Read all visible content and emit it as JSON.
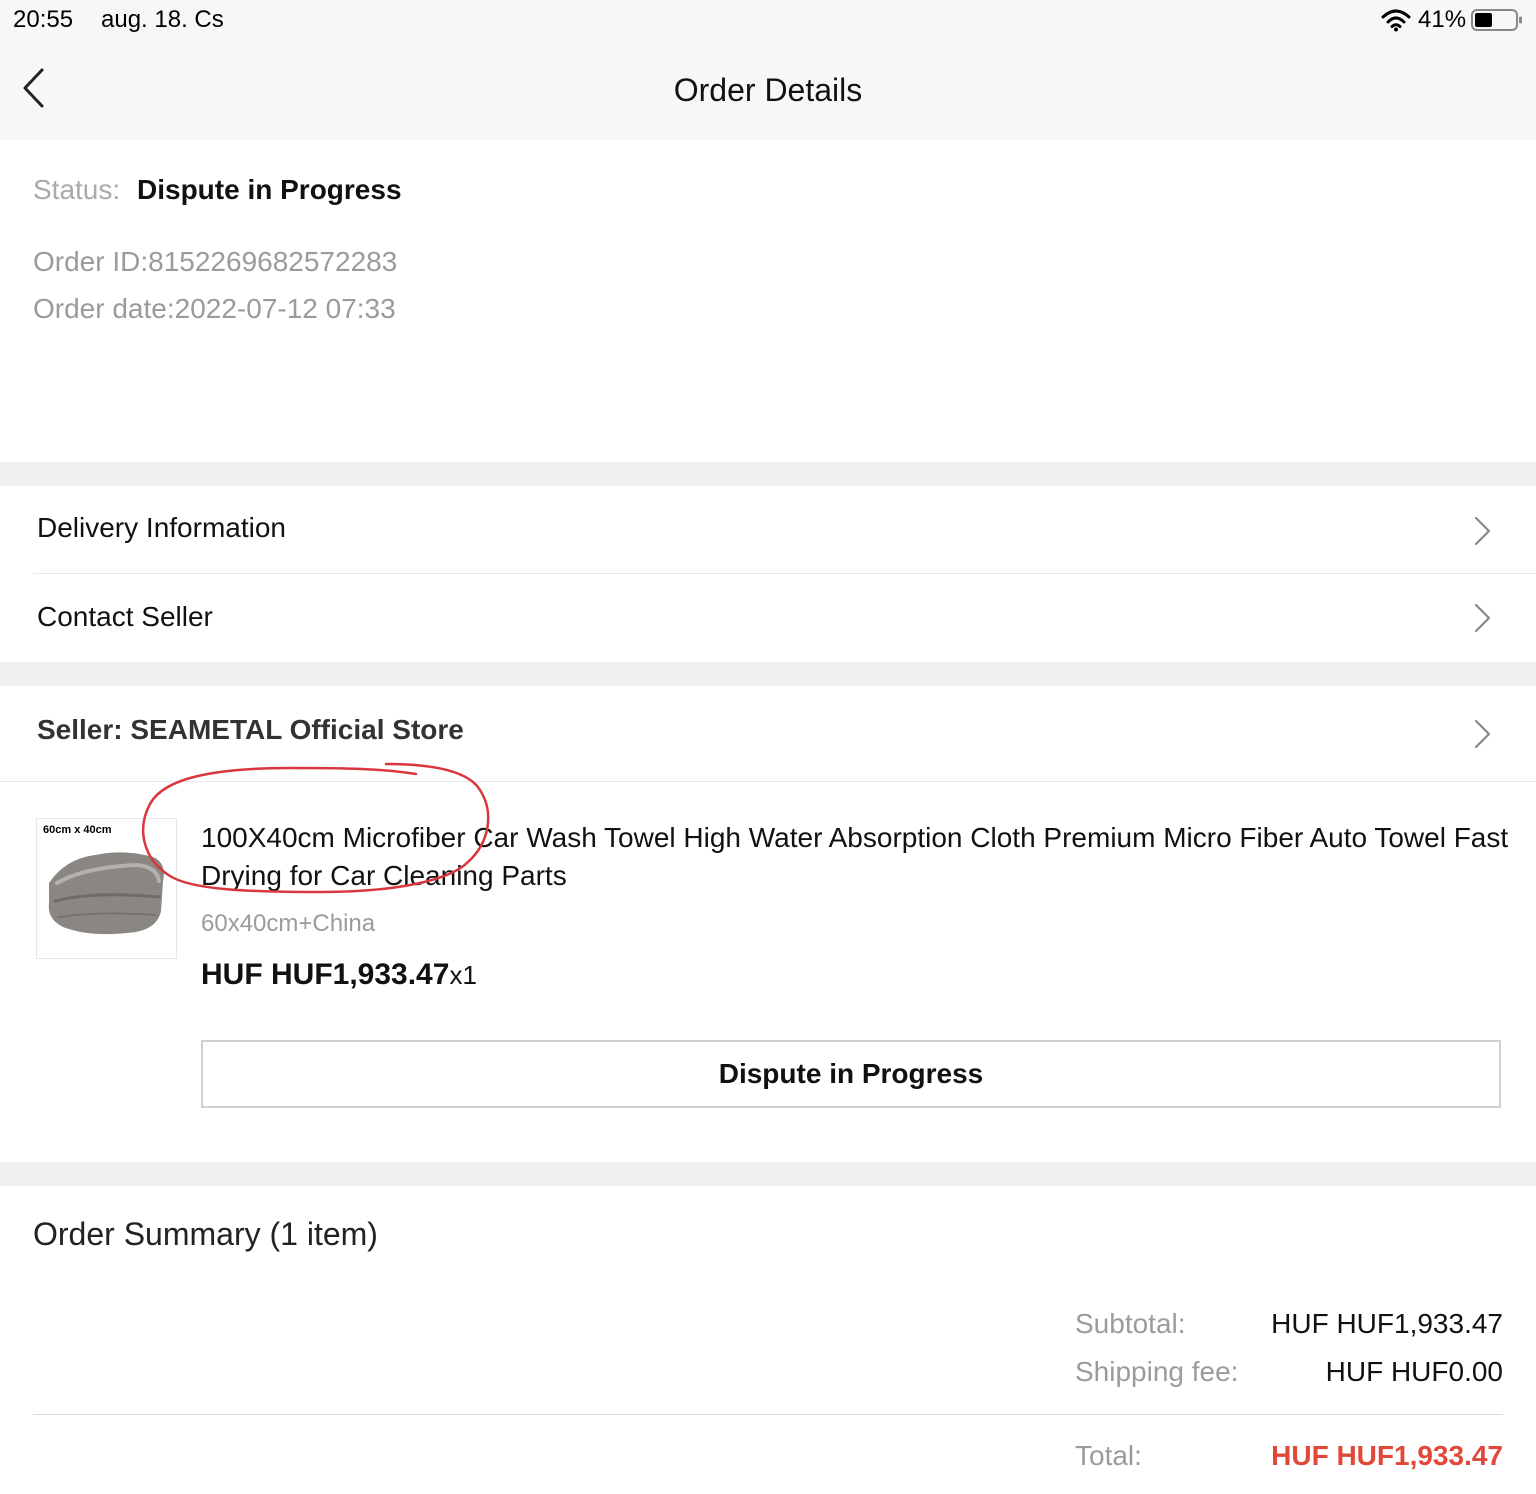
{
  "status_bar": {
    "time": "20:55",
    "date": "aug. 18. Cs",
    "battery": "41%"
  },
  "header": {
    "title": "Order Details",
    "back_icon": "chevron-left-icon"
  },
  "order": {
    "status_label": "Status:",
    "status_value": "Dispute in Progress",
    "order_id": "Order ID:8152269682572283",
    "order_date": "Order date:2022-07-12 07:33"
  },
  "menu": {
    "delivery_label": "Delivery Information",
    "contact_label": "Contact Seller"
  },
  "seller": {
    "name": "Seller: SEAMETAL Official Store"
  },
  "product": {
    "image_caption": "60cm x 40cm",
    "title": "100X40cm Microfiber Car Wash Towel High Water Absorption Cloth Premium Micro Fiber Auto Towel Fast Drying for Car Cleaning Parts",
    "variant": "60x40cm+China",
    "price": "HUF HUF1,933.47",
    "quantity": "x1",
    "action_label": "Dispute in Progress"
  },
  "summary": {
    "title": "Order Summary (1 item)",
    "subtotal_label": "Subtotal:",
    "subtotal_value": "HUF HUF1,933.47",
    "shipping_label": "Shipping fee:",
    "shipping_value": "HUF HUF0.00",
    "total_label": "Total:",
    "total_value": "HUF HUF1,933.47"
  },
  "colors": {
    "accent": "#e0493a",
    "annotation": "#d9363e",
    "muted_text": "#9b9b9b",
    "separator": "#f0f0f0"
  }
}
